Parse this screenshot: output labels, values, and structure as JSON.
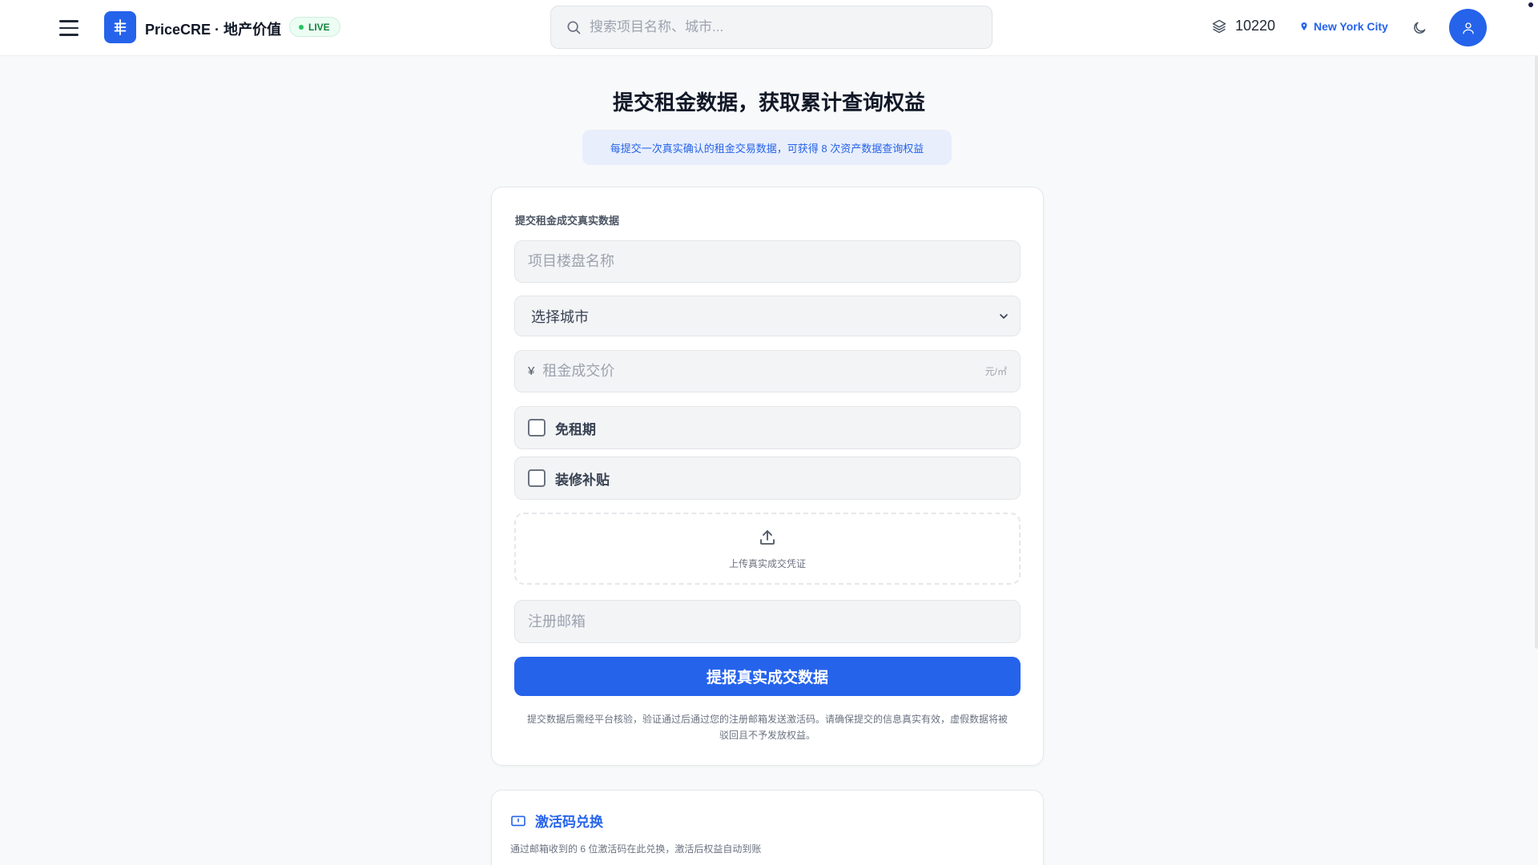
{
  "header": {
    "brand": "PriceCRE · 地产价值",
    "live_label": "LIVE",
    "search_placeholder": "搜索项目名称、城市...",
    "credits": "10220",
    "location": "New York City",
    "icons": {
      "menu": "hamburger-menu-icon",
      "logo": "building-logo-icon",
      "search": "search-icon",
      "credits": "layers-stack-icon",
      "location": "map-pin-icon",
      "theme": "moon-icon",
      "avatar": "user-icon"
    }
  },
  "page": {
    "title": "提交租金数据，获取累计查询权益",
    "info": "每提交一次真实确认的租金交易数据，可获得 8 次资产数据查询权益"
  },
  "form": {
    "section_label": "提交租金成交真实数据",
    "project_placeholder": "项目楼盘名称",
    "city_selected": "选择城市",
    "price_prefix": "¥",
    "price_placeholder": "租金成交价",
    "price_unit": "元/㎡",
    "checkbox_rent_free": "免租期",
    "checkbox_decoration": "装修补贴",
    "upload_label": "上传真实成交凭证",
    "email_placeholder": "注册邮箱",
    "submit_label": "提报真实成交数据",
    "disclaimer": "提交数据后需经平台核验，验证通过后通过您的注册邮箱发送激活码。请确保提交的信息真实有效，虚假数据将被驳回且不予发放权益。"
  },
  "redeem": {
    "title": "激活码兑换",
    "description": "通过邮箱收到的 6 位激活码在此兑换，激活后权益自动到账"
  },
  "colors": {
    "accent": "#2563eb",
    "live_green": "#22c55e",
    "background": "#f8f9fa"
  }
}
